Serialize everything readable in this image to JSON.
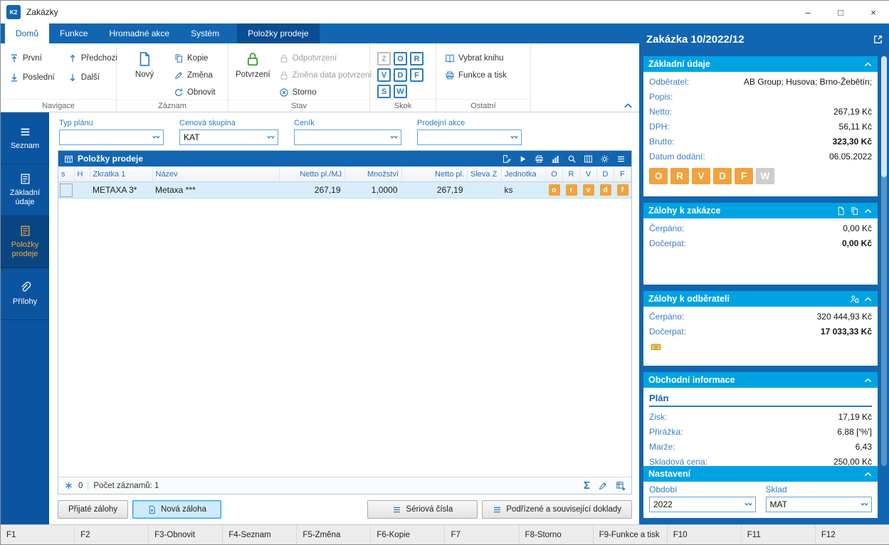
{
  "colors": {
    "ribbon_blue": "#1266b1",
    "contextual_tab": "#0a4d93",
    "section_cyan": "#00a3e2",
    "orange": "#f0a23c",
    "sidebar_blue": "#0b55a0",
    "label_blue": "#3c80c0"
  },
  "window": {
    "title": "Zakázky",
    "logo": "K2"
  },
  "titlebar": {
    "minimize": "–",
    "maximize": "□",
    "close": "×"
  },
  "ribbon": {
    "tabs": [
      {
        "label": "Domů"
      },
      {
        "label": "Funkce"
      },
      {
        "label": "Hromadné akce"
      },
      {
        "label": "Systém"
      },
      {
        "label": "Položky prodeje"
      }
    ],
    "navigace": {
      "group": "Navigace",
      "first": "První",
      "prev": "Předchozi",
      "last": "Poslední",
      "next": "Další"
    },
    "zaznam": {
      "group": "Záznam",
      "new": "Nový",
      "copy": "Kopie",
      "change": "Změna",
      "refresh": "Obnovit"
    },
    "stav": {
      "group": "Stav",
      "confirm": "Potvrzení",
      "unconfirm": "Odpotvrzení",
      "change_date": "Změna data potvrzení",
      "storno": "Storno"
    },
    "skok": {
      "group": "Skok",
      "letters": [
        "Z",
        "O",
        "R",
        "V",
        "D",
        "F",
        "S",
        "W"
      ]
    },
    "ostatni": {
      "group": "Ostatní",
      "pick_book": "Vybrat knihu",
      "func_print": "Funkce a tisk"
    }
  },
  "sidebar": {
    "items": [
      {
        "label": "Seznam"
      },
      {
        "label": "Základní údaje"
      },
      {
        "label": "Položky prodeje"
      },
      {
        "label": "Přílohy"
      }
    ]
  },
  "filters": {
    "typ_planu": {
      "label": "Typ plánu",
      "value": ""
    },
    "cenova_skupina": {
      "label": "Cenová skupina",
      "value": "KAT"
    },
    "cenik": {
      "label": "Ceník",
      "value": ""
    },
    "prodejni_akce": {
      "label": "Prodejní akce",
      "value": ""
    }
  },
  "grid": {
    "title": "Položky prodeje",
    "columns": [
      "s",
      "H",
      "Zkratka 1",
      "Název",
      "Netto pl./MJ",
      "Množství",
      "Netto pl.",
      "Sleva Z",
      "Jednotka",
      "O",
      "R",
      "V",
      "D",
      "F"
    ],
    "row": {
      "zkratka": "METAXA 3*",
      "nazev": "Metaxa ***",
      "netto_mj": "267,19",
      "mnozstvi": "1,0000",
      "netto_pl": "267,19",
      "sleva": "",
      "jednotka": "ks",
      "flags": [
        "o",
        "r",
        "v",
        "d",
        "f"
      ]
    },
    "footer": {
      "counter": "0",
      "count": "Počet záznamů: 1"
    }
  },
  "actions": {
    "prijate_zalohy": "Přijaté zálohy",
    "nova_zaloha": "Nová záloha",
    "seriova_cisla": "Sériová čísla",
    "podrizene": "Podřízené a související doklady"
  },
  "panel": {
    "title": "Zakázka 10/2022/12",
    "zakladni": {
      "title": "Základní údaje",
      "rows": [
        {
          "label": "Odběratel:",
          "value": "AB Group; Husova; Brno-Žebětín;"
        },
        {
          "label": "Popis:",
          "value": ""
        },
        {
          "label": "Netto:",
          "value": "267,19 Kč"
        },
        {
          "label": "DPH:",
          "value": "56,11 Kč"
        },
        {
          "label": "Brutto:",
          "value": "323,30 Kč"
        },
        {
          "label": "Datum dodání:",
          "value": "06.05.2022"
        }
      ],
      "letters": [
        "O",
        "R",
        "V",
        "D",
        "F",
        "W"
      ]
    },
    "zalohy_zakazka": {
      "title": "Zálohy k zakázce",
      "rows": [
        {
          "label": "Čerpáno:",
          "value": "0,00 Kč"
        },
        {
          "label": "Dočerpat:",
          "value": "0,00 Kč"
        }
      ]
    },
    "zalohy_odberatel": {
      "title": "Zálohy k odběrateli",
      "rows": [
        {
          "label": "Čerpáno:",
          "value": "320 444,93 Kč"
        },
        {
          "label": "Dočerpat:",
          "value": "17 033,33 Kč"
        }
      ]
    },
    "obchodni": {
      "title": "Obchodní informace",
      "subtitle": "Plán",
      "rows": [
        {
          "label": "Zisk:",
          "value": "17,19 Kč"
        },
        {
          "label": "Přirážka:",
          "value": "6,88 ['%']"
        },
        {
          "label": "Marže:",
          "value": "6,43"
        },
        {
          "label": "Skladová cena:",
          "value": "250,00 Kč"
        }
      ]
    },
    "nastaveni": {
      "title": "Nastavení",
      "obdobi": {
        "label": "Období",
        "value": "2022"
      },
      "sklad": {
        "label": "Sklad",
        "value": "MAT"
      }
    }
  },
  "fkeys": [
    "F1",
    "F2",
    "F3-Obnovit",
    "F4-Seznam",
    "F5-Změna",
    "F6-Kopie",
    "F7",
    "F8-Storno",
    "F9-Funkce a tisk",
    "F10",
    "F11",
    "F12"
  ]
}
